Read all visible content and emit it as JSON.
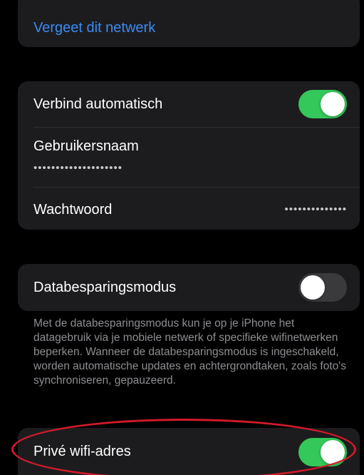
{
  "forget_section": {
    "forget_network_label": "Vergeet dit netwerk"
  },
  "credentials_section": {
    "auto_join_label": "Verbind automatisch",
    "auto_join_on": true,
    "username_label": "Gebruikersnaam",
    "username_value": "••••••••••••••••••••",
    "password_label": "Wachtwoord",
    "password_value": "••••••••••••••"
  },
  "low_data_section": {
    "low_data_label": "Databesparingsmodus",
    "low_data_on": false,
    "low_data_footer": "Met de databesparingsmodus kun je op je iPhone het datagebruik via je mobiele netwerk of specifieke wifinetwerken beperken. Wanneer de databesparingsmodus is ingeschakeld, worden automatische updates en achtergrondtaken, zoals foto's synchroniseren, gepauzeerd."
  },
  "private_address_section": {
    "private_address_label": "Privé wifi-adres",
    "private_address_on": true
  },
  "colors": {
    "background": "#000000",
    "group_background": "#1c1c1e",
    "link_blue": "#3a8bf5",
    "toggle_on": "#34c759",
    "toggle_off": "#3a3a3c",
    "annotation_red": "#d11a2a"
  }
}
